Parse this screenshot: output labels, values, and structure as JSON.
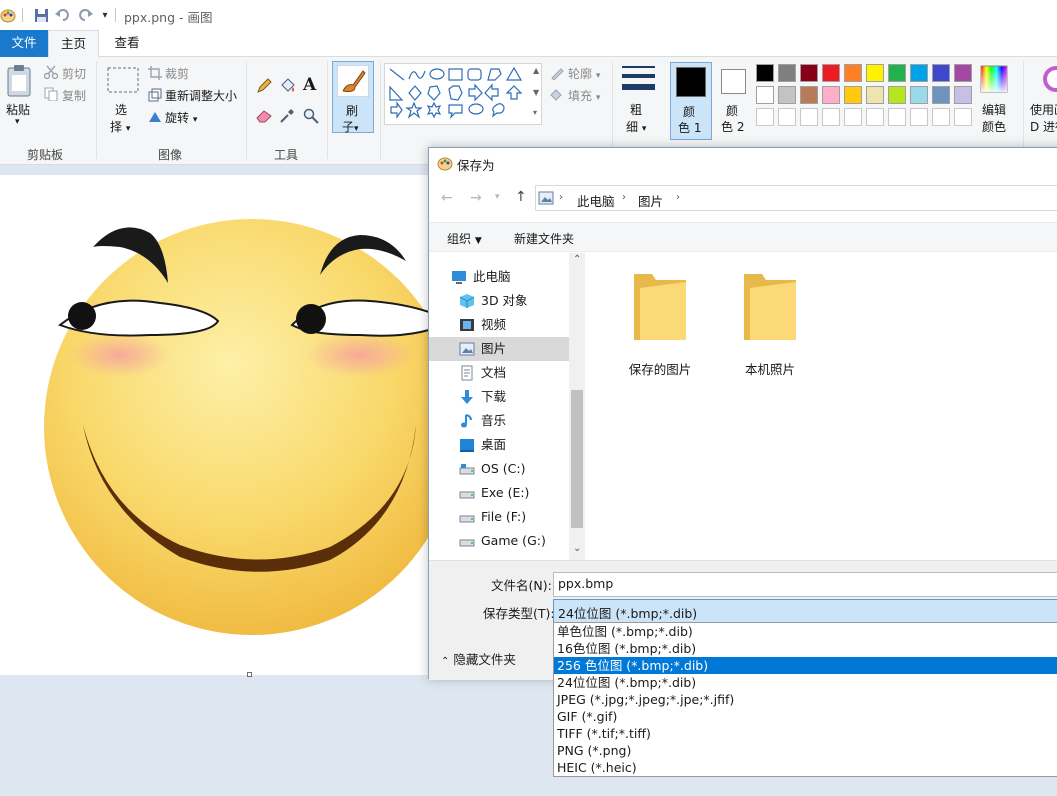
{
  "window": {
    "title": "ppx.png - 画图"
  },
  "tabs": {
    "file": "文件",
    "home": "主页",
    "view": "查看"
  },
  "ribbon": {
    "clipboard": {
      "group_label": "剪贴板",
      "paste": "粘贴",
      "cut": "剪切",
      "copy": "复制"
    },
    "image": {
      "group_label": "图像",
      "select_line1": "选",
      "select_line2": "择",
      "crop": "裁剪",
      "resize": "重新调整大小",
      "rotate": "旋转"
    },
    "tools": {
      "group_label": "工具"
    },
    "brushes": {
      "line1": "刷",
      "line2": "子"
    },
    "shapes": {
      "outline": "轮廓",
      "fill": "填充"
    },
    "size": {
      "line1": "粗",
      "line2": "细"
    },
    "colors": {
      "color1_line1": "颜",
      "color1_line2": "色 1",
      "color2_line1": "颜",
      "color2_line2": "色 2",
      "edit_line1": "编辑",
      "edit_line2": "颜色",
      "paint3d_line1": "使用画",
      "paint3d_line2": "D 进行",
      "color1_value": "#000000",
      "color2_value": "#ffffff",
      "palette": [
        "#000000",
        "#7f7f7f",
        "#880015",
        "#ed1c24",
        "#ff7f27",
        "#fff200",
        "#22b14c",
        "#00a2e8",
        "#3f48cc",
        "#a349a4",
        "#ffffff",
        "#c3c3c3",
        "#b97a57",
        "#ffaec9",
        "#ffc90e",
        "#efe4b0",
        "#b5e61d",
        "#99d9ea",
        "#7092be",
        "#c8bfe7"
      ]
    }
  },
  "dialog": {
    "title": "保存为",
    "breadcrumb": [
      "此电脑",
      "图片"
    ],
    "commands": {
      "organize": "组织",
      "new_folder": "新建文件夹"
    },
    "nav": [
      {
        "label": "此电脑",
        "icon": "computer-icon"
      },
      {
        "label": "3D 对象",
        "icon": "3d-objects-icon"
      },
      {
        "label": "视频",
        "icon": "video-icon"
      },
      {
        "label": "图片",
        "icon": "pictures-icon",
        "selected": true
      },
      {
        "label": "文档",
        "icon": "documents-icon"
      },
      {
        "label": "下载",
        "icon": "download-icon"
      },
      {
        "label": "音乐",
        "icon": "music-icon"
      },
      {
        "label": "桌面",
        "icon": "desktop-icon"
      },
      {
        "label": "OS (C:)",
        "icon": "drive-c-icon"
      },
      {
        "label": "Exe (E:)",
        "icon": "drive-icon"
      },
      {
        "label": "File (F:)",
        "icon": "drive-icon"
      },
      {
        "label": "Game (G:)",
        "icon": "drive-icon"
      }
    ],
    "folders": [
      "保存的图片",
      "本机照片"
    ],
    "filename_label": "文件名(N):",
    "filename_value": "ppx.bmp",
    "filetype_label": "保存类型(T):",
    "filetype_value": "24位位图 (*.bmp;*.dib)",
    "hide_folders": "隐藏文件夹",
    "filetype_options": [
      "单色位图 (*.bmp;*.dib)",
      "16色位图 (*.bmp;*.dib)",
      "256 色位图 (*.bmp;*.dib)",
      "24位位图 (*.bmp;*.dib)",
      "JPEG (*.jpg;*.jpeg;*.jpe;*.jfif)",
      "GIF (*.gif)",
      "TIFF (*.tif;*.tiff)",
      "PNG (*.png)",
      "HEIC (*.heic)"
    ],
    "highlighted_option": 2
  }
}
